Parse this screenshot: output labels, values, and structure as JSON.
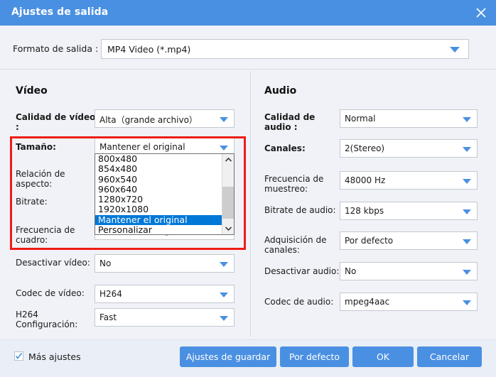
{
  "window": {
    "title": "Ajustes de salida",
    "close_icon": "close-icon"
  },
  "format_row": {
    "label": "Formato de salida :",
    "value": "MP4 Video (*.mp4)"
  },
  "video": {
    "section_title": "Vídeo",
    "fields": [
      {
        "label": "Calidad de vídeo :",
        "value": "Alta（grande archivo）",
        "bold": true
      },
      {
        "label": "Tamaño:",
        "value": "Mantener el original",
        "bold": true
      },
      {
        "label": "Relación de aspecto:",
        "value": "",
        "bold": false
      },
      {
        "label": "Bitrate:",
        "value": "",
        "bold": false
      },
      {
        "label": "Frecuencia de cuadro:",
        "value": "Mantener el original",
        "bold": false
      },
      {
        "label": "Desactivar vídeo:",
        "value": "No",
        "bold": false
      },
      {
        "label": "Codec de vídeo:",
        "value": "H264",
        "bold": false
      },
      {
        "label": "H264 Configuración:",
        "value": "Fast",
        "bold": false
      }
    ]
  },
  "audio": {
    "section_title": "Audio",
    "fields": [
      {
        "label": "Calidad de audio :",
        "value": "Normal",
        "bold": true
      },
      {
        "label": "Canales:",
        "value": "2(Stereo)",
        "bold": true
      },
      {
        "label": "Frecuencia de muestreo:",
        "value": "48000 Hz",
        "bold": false
      },
      {
        "label": "Bitrate de audio:",
        "value": "128 kbps",
        "bold": false
      },
      {
        "label": "Adquisición de canales:",
        "value": "Por defecto",
        "bold": false
      },
      {
        "label": "Desactivar audio:",
        "value": "No",
        "bold": false
      },
      {
        "label": "Codec de audio:",
        "value": "mpeg4aac",
        "bold": false
      }
    ]
  },
  "size_dropdown": {
    "options": [
      "800x480",
      "854x480",
      "960x540",
      "960x640",
      "1280x720",
      "1920x1080",
      "Mantener el original",
      "Personalizar"
    ],
    "selected": "Mantener el original",
    "scroll_up_icon": "chevron-up-icon",
    "scroll_down_icon": "chevron-down-icon"
  },
  "footer": {
    "checkbox_label": "Más ajustes",
    "checkbox_checked": true,
    "buttons": [
      {
        "label": "Ajustes de guardar"
      },
      {
        "label": "Por defecto"
      },
      {
        "label": "OK"
      },
      {
        "label": "Cancelar"
      }
    ]
  },
  "colors": {
    "accent": "#4a90e2",
    "highlight_box": "#ee1c15",
    "list_selection": "#0078d7",
    "panel_bg": "#f0f2f7",
    "footer_bg": "#eaeef6"
  }
}
